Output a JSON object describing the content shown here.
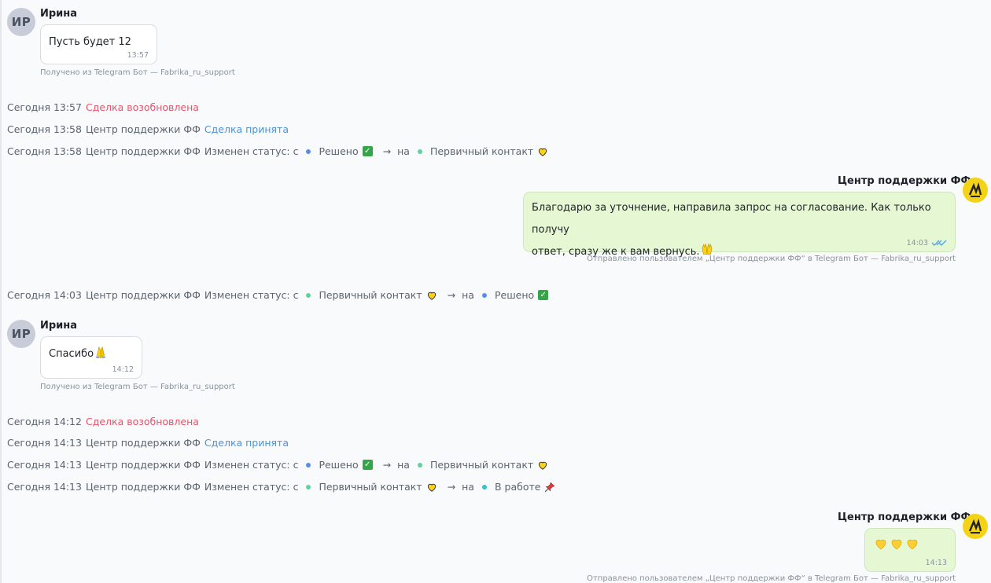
{
  "app": {
    "accent_in": "#ffffff",
    "accent_out": "#e6f8d3",
    "red": "#e5546b",
    "blue": "#4c93d8"
  },
  "messages": [
    {
      "avatar": "ИР",
      "sender": "Ирина",
      "text": "Пусть будет 12",
      "time": "13:57",
      "meta": "Получено из Telegram Бот — Fabrika_ru_support"
    },
    {
      "sender": "Центр поддержки ФФ",
      "text_line1": "Благодарю за уточнение, направила запрос на согласование. Как только получу",
      "text_line2": "ответ, сразу же к вам вернусь.",
      "emoji": "raised-hands",
      "time": "14:03",
      "meta": "Отправлено пользователем „Центр поддержки ФФ“ в Telegram Бот — Fabrika_ru_support"
    },
    {
      "avatar": "ИР",
      "sender": "Ирина",
      "text": "Спасибо",
      "emoji": "folded-hands",
      "time": "14:12",
      "meta": "Получено из Telegram Бот — Fabrika_ru_support"
    },
    {
      "sender": "Центр поддержки ФФ",
      "emoji": "three-yellow-hearts",
      "time": "14:13",
      "meta": "Отправлено пользователем „Центр поддержки ФФ“ в Telegram Бот — Fabrika_ru_support"
    }
  ],
  "events": [
    {
      "time": "Сегодня 13:57",
      "action": "Сделка возобновлена"
    },
    {
      "time": "Сегодня 13:58",
      "actor": "Центр поддержки ФФ",
      "action": "Сделка принята"
    },
    {
      "time": "Сегодня 13:58",
      "actor": "Центр поддержки ФФ",
      "label": "Изменен статус: с",
      "from": "Решено",
      "to_label": "на",
      "to": "Первичный контакт"
    },
    {
      "time": "Сегодня 14:03",
      "actor": "Центр поддержки ФФ",
      "label": "Изменен статус: с",
      "from": "Первичный контакт",
      "to_label": "на",
      "to": "Решено"
    },
    {
      "time": "Сегодня 14:12",
      "action": "Сделка возобновлена"
    },
    {
      "time": "Сегодня 14:13",
      "actor": "Центр поддержки ФФ",
      "action": "Сделка принята"
    },
    {
      "time": "Сегодня 14:13",
      "actor": "Центр поддержки ФФ",
      "label": "Изменен статус: с",
      "from": "Решено",
      "to_label": "на",
      "to": "Первичный контакт"
    },
    {
      "time": "Сегодня 14:13",
      "actor": "Центр поддержки ФФ",
      "label": "Изменен статус: с",
      "from": "Первичный контакт",
      "to_label": "на",
      "to": "В работе"
    }
  ],
  "status_colors": {
    "Решено": "#5b8de8",
    "Первичный контакт": "#5fd39a",
    "В работе": "#2ec4d1"
  }
}
